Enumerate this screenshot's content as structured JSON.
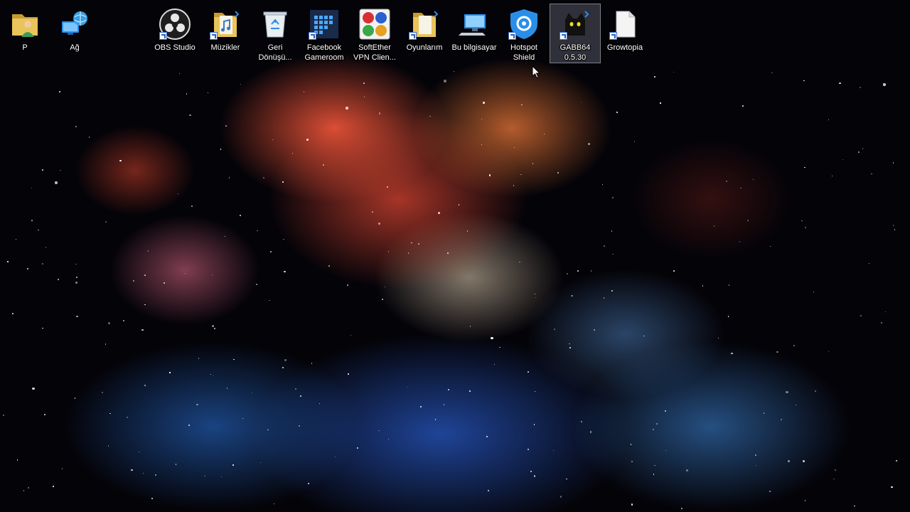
{
  "desktop": {
    "icons": [
      {
        "label": "P",
        "icon": "user-folder-icon",
        "shortcut": false,
        "selected": false
      },
      {
        "label": "Ağ",
        "icon": "network-icon",
        "shortcut": false,
        "selected": false
      },
      {
        "label": "OBS Studio",
        "icon": "obs-studio-icon",
        "shortcut": true,
        "selected": false
      },
      {
        "label": "Müzikler",
        "icon": "music-folder-icon",
        "shortcut": true,
        "selected": false
      },
      {
        "label": "Geri\nDönüşü...",
        "icon": "recycle-bin-icon",
        "shortcut": false,
        "selected": false
      },
      {
        "label": "Facebook\nGameroom",
        "icon": "facebook-gameroom-icon",
        "shortcut": true,
        "selected": false
      },
      {
        "label": "SoftEther\nVPN Clien...",
        "icon": "softether-vpn-icon",
        "shortcut": false,
        "selected": false
      },
      {
        "label": "Oyunlarım",
        "icon": "games-folder-icon",
        "shortcut": true,
        "selected": false
      },
      {
        "label": "Bu bilgisayar",
        "icon": "this-pc-icon",
        "shortcut": false,
        "selected": false
      },
      {
        "label": "Hotspot\nShield",
        "icon": "hotspot-shield-icon",
        "shortcut": true,
        "selected": false
      },
      {
        "label": "GABB64\n0.5.30",
        "icon": "gabb64-cat-icon",
        "shortcut": true,
        "selected": true
      },
      {
        "label": "Growtopia",
        "icon": "growtopia-file-icon",
        "shortcut": true,
        "selected": false
      }
    ]
  },
  "colors": {
    "folder": "#e8c45a",
    "folder_dark": "#c99a2e",
    "accent_blue": "#2a8ee8",
    "selection": "#c8d2e6"
  }
}
